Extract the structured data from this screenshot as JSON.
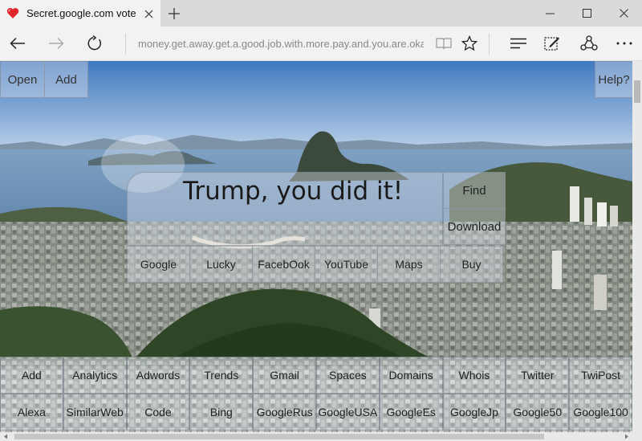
{
  "browser": {
    "tab_title": "Secret.google.com vote",
    "address": "money.get.away.get.a.good.job.with.more.pay.and.you.are.oka"
  },
  "page": {
    "top_buttons": {
      "open": "Open",
      "add": "Add",
      "help": "Help?"
    },
    "search_text": "Trump, you did it!",
    "side_buttons": {
      "find": "Find",
      "download": "Download"
    },
    "quick_links": [
      "Google",
      "Lucky",
      "FacebOok",
      "YouTube",
      "Maps",
      "Buy"
    ],
    "grid_row1": [
      "Add",
      "Analytics",
      "Adwords",
      "Trends",
      "Gmail",
      "Spaces",
      "Domains",
      "Whois",
      "Twitter",
      "TwiPost"
    ],
    "grid_row2": [
      "Alexa",
      "SimilarWeb",
      "Code",
      "Bing",
      "GoogleRus",
      "GoogleUSA",
      "GoogleEs",
      "GoogleJp",
      "Google50",
      "Google100"
    ]
  }
}
